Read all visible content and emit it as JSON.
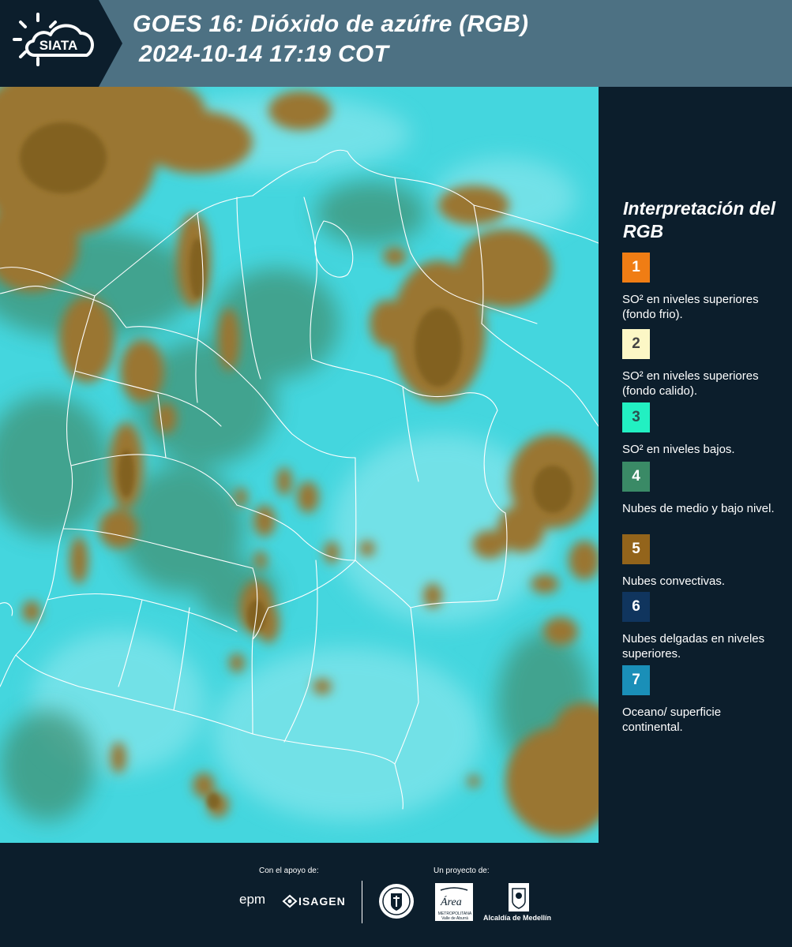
{
  "header": {
    "logo_text": "SIATA",
    "title_line1": "GOES 16: Dióxido de azúfre (RGB)",
    "title_line2": "2024-10-14 17:19 COT"
  },
  "legend": {
    "title": "Interpretación del RGB",
    "items": [
      {
        "number": "1",
        "label": "SO² en niveles superiores (fondo frio).",
        "color": "#f07d14",
        "text_color": "#ffffff"
      },
      {
        "number": "2",
        "label": "SO² en niveles superiores (fondo calido).",
        "color": "#fcf7c6",
        "text_color": "#444444"
      },
      {
        "number": "3",
        "label": "SO² en niveles bajos.",
        "color": "#22f0c2",
        "text_color": "#2a5050"
      },
      {
        "number": "4",
        "label": "Nubes de medio y bajo nivel.",
        "color": "#3a8a66",
        "text_color": "#ffffff"
      },
      {
        "number": "5",
        "label": "Nubes convectivas.",
        "color": "#93641b",
        "text_color": "#ffffff"
      },
      {
        "number": "6",
        "label": "Nubes delgadas en niveles superiores.",
        "color": "#10355e",
        "text_color": "#ffffff"
      },
      {
        "number": "7",
        "label": "Oceano/ superficie continental.",
        "color": "#1a8fb8",
        "text_color": "#ffffff"
      }
    ]
  },
  "footer": {
    "support_label": "Con el apoyo de:",
    "project_label": "Un proyecto de:",
    "sponsors": [
      "epm",
      "ISAGEN"
    ],
    "partner_area": "Área",
    "partner_area_sub": "METROPOLITANA Valle de Aburrá",
    "partner_alcaldia": "Alcaldía de Medellín"
  },
  "colors": {
    "background": "#0c1e2c",
    "header": "#4d7183",
    "surface_cyan": "#41d9e0",
    "cloud_brown": "#9d7a2f",
    "cloud_green": "#3f9275"
  }
}
